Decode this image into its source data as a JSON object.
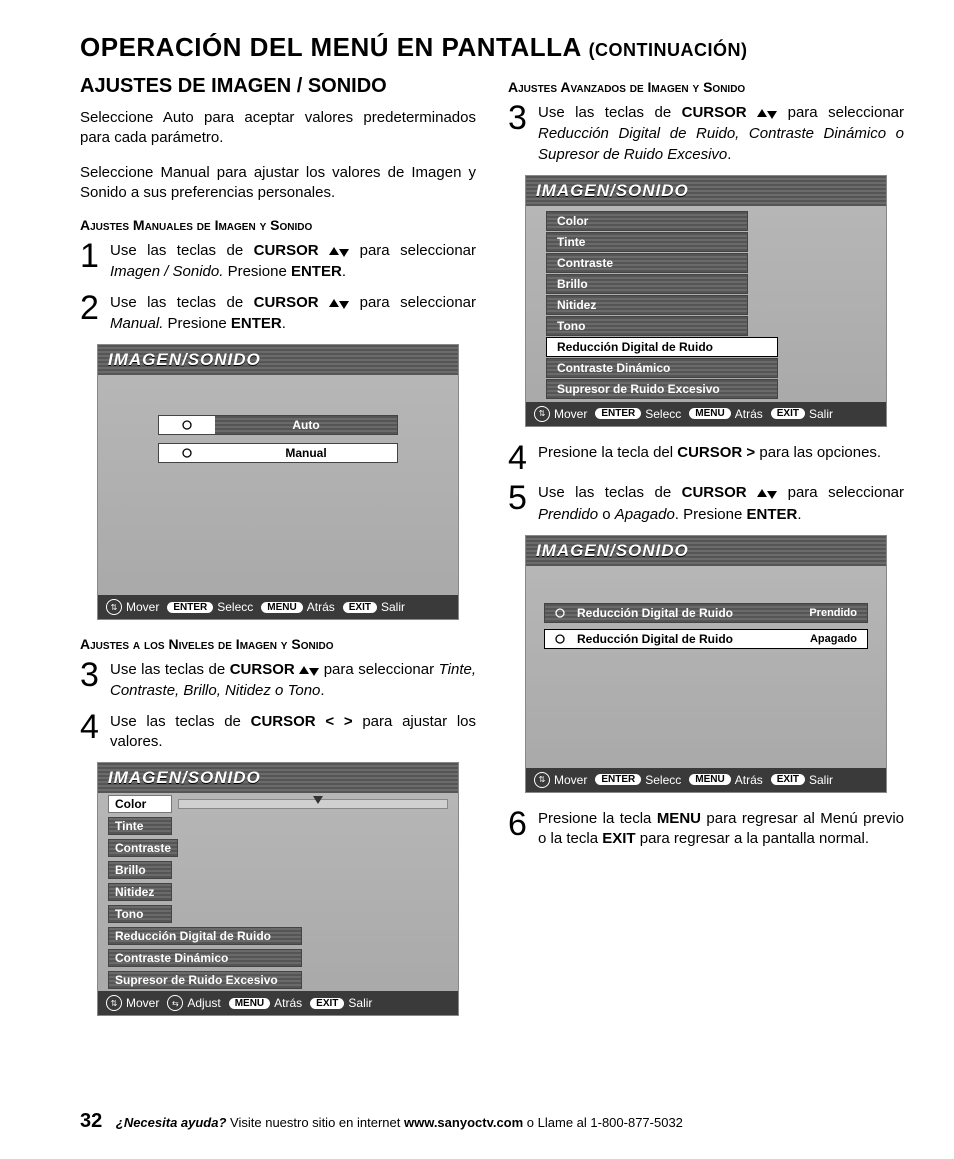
{
  "title": "OPERACIÓN DEL MENÚ EN PANTALLA",
  "title_cont": "(CONTINUACIÓN)",
  "left": {
    "h2": "AJUSTES DE IMAGEN / SONIDO",
    "p1": "Seleccione Auto para aceptar valores predeterminados para cada parámetro.",
    "p2": "Seleccione Manual para ajustar los valores de Imagen y Sonido a sus preferencias personales.",
    "h3a": "Ajustes Manuales de Imagen y Sonido",
    "s1a": "Use las teclas de ",
    "s1b": " para seleccionar ",
    "s1c": "Imagen / Sonido.",
    "s1d": " Presione ",
    "s2a": "Use las teclas de ",
    "s2b": " para seleccionar ",
    "s2c": "Manual.",
    "s2d": " Presione ",
    "cursor": "CURSOR",
    "enter": "ENTER",
    "osd1": {
      "title": "IMAGEN/SONIDO",
      "auto": "Auto",
      "manual": "Manual",
      "mover": "Mover",
      "selecc": "Selecc",
      "atras": "Atrás",
      "salir": "Salir",
      "k_enter": "ENTER",
      "k_menu": "MENU",
      "k_exit": "EXIT"
    },
    "h3b": "Ajustes a los Niveles de Imagen y Sonido",
    "s3a": "Use las teclas de ",
    "s3b": " para seleccionar ",
    "s3c": "Tinte, Contraste, Brillo, Nitidez o Tono",
    "s4a": "Use las teclas de ",
    "s4b": "CURSOR < >",
    "s4c": " para ajustar los valores.",
    "osd2": {
      "title": "IMAGEN/SONIDO",
      "items": [
        "Color",
        "Tinte",
        "Contraste",
        "Brillo",
        "Nitidez",
        "Tono",
        "Reducción Digital de Ruido",
        "Contraste Dinámico",
        "Supresor de Ruido Excesivo"
      ],
      "mover": "Mover",
      "adjust": "Adjust",
      "atras": "Atrás",
      "salir": "Salir",
      "k_menu": "MENU",
      "k_exit": "EXIT"
    }
  },
  "right": {
    "h3a": "Ajustes Avanzados de Imagen y Sonido",
    "s3a": "Use las teclas de ",
    "s3b": " para seleccionar ",
    "s3c": "Reducción Digital de Ruido, Contraste Dinámico o Supresor de Ruido Excesivo",
    "osd1": {
      "title": "IMAGEN/SONIDO",
      "items": [
        "Color",
        "Tinte",
        "Contraste",
        "Brillo",
        "Nitidez",
        "Tono",
        "Reducción Digital de Ruido",
        "Contraste Dinámico",
        "Supresor de Ruido Excesivo"
      ],
      "mover": "Mover",
      "selecc": "Selecc",
      "atras": "Atrás",
      "salir": "Salir",
      "k_enter": "ENTER",
      "k_menu": "MENU",
      "k_exit": "EXIT"
    },
    "s4a": "Presione la tecla del ",
    "s4b": "CURSOR >",
    "s4c": " para las opciones.",
    "s5a": "Use las teclas de ",
    "s5b": " para seleccionar ",
    "s5c": "Prendido",
    "s5d": " o ",
    "s5e": "Apagado",
    "s5f": ". Presione ",
    "osd2": {
      "title": "IMAGEN/SONIDO",
      "opt_label": "Reducción Digital de Ruido",
      "on": "Prendido",
      "off": "Apagado",
      "mover": "Mover",
      "selecc": "Selecc",
      "atras": "Atrás",
      "salir": "Salir",
      "k_enter": "ENTER",
      "k_menu": "MENU",
      "k_exit": "EXIT"
    },
    "s6a": "Presione la tecla ",
    "s6b": "MENU",
    "s6c": " para regresar al Menú previo o la tecla ",
    "s6d": "EXIT",
    "s6e": " para regresar a la pantalla normal."
  },
  "footer": {
    "page": "32",
    "q": "¿Necesita ayuda?",
    "t1": " Visite nuestro sitio en internet ",
    "url": "www.sanyoctv.com",
    "t2": " o Llame al 1-800-877-5032"
  }
}
